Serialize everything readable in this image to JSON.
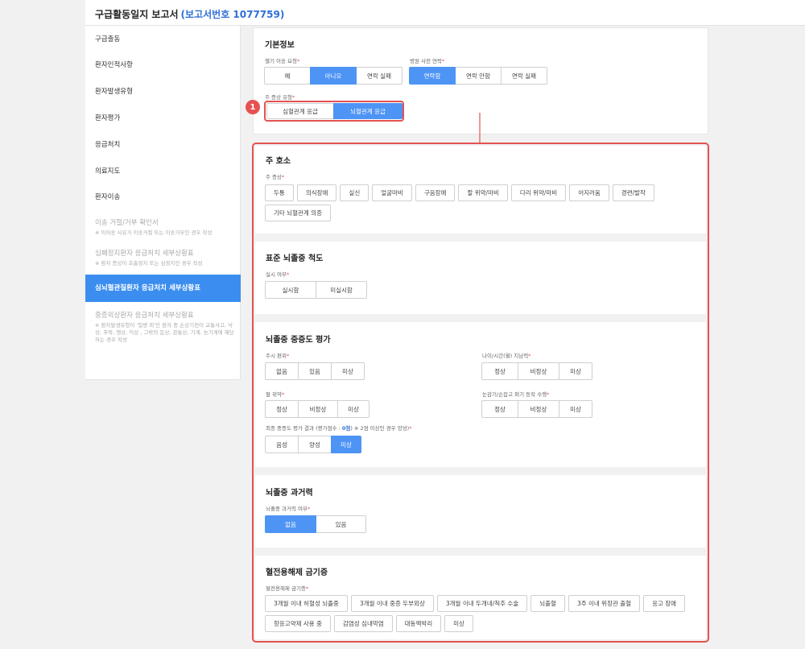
{
  "header": {
    "title": "구급활동일지 보고서",
    "report_no": "(보고서번호 1077759)"
  },
  "sidebar": {
    "items": [
      {
        "label": "구급출동"
      },
      {
        "label": "환자인적사항"
      },
      {
        "label": "환자발생유형"
      },
      {
        "label": "환자평가"
      },
      {
        "label": "응급처치"
      },
      {
        "label": "의료지도"
      },
      {
        "label": "환자이송"
      },
      {
        "label": "이송 거절/거부 확인서",
        "note": "※ 이어송 사유가 이송거절 또는 이송거부인 경우 작성"
      },
      {
        "label": "심폐정지환자 응급처치 세부상황표",
        "note": "※ 환자 증상이 호흡정지 또는 심정지인 경우 작성"
      },
      {
        "label": "심뇌혈관질환자 응급처치 세부상황표"
      },
      {
        "label": "중증외상환자 응급처치 세부상황표",
        "note": "※ 환자발생유형이 '질병 외'인 환자 중 손상기전이 교통사고, 낙상, 추락, 행상, 익상 , 그밖의 둔상, 관통상, 기계, 농기계에 해당하는 경우 작성"
      }
    ]
  },
  "basic": {
    "title": "기본정보",
    "heli": {
      "label": "헬기 이송 요청",
      "options": [
        "예",
        "아니오",
        "연락 실패"
      ],
      "selected": 1
    },
    "hospital": {
      "label": "병원 사전 연락",
      "options": [
        "연락함",
        "연락 안함",
        "연락 실패"
      ],
      "selected": 0
    },
    "symptom_type": {
      "label": "주 증상 유형",
      "options": [
        "심혈관계 응급",
        "뇌혈관계 응급"
      ],
      "selected": 1
    },
    "badge": "1"
  },
  "chief": {
    "title": "주 호소",
    "label": "주 증상",
    "chips": [
      "두통",
      "의식장애",
      "실신",
      "얼굴마비",
      "구음장애",
      "팔 위약/마비",
      "다리 위약/마비",
      "어지러움",
      "경련/발작",
      "기타 뇌혈관계 의증"
    ]
  },
  "scale": {
    "title": "표준 뇌졸중 척도",
    "label": "실시 여부",
    "options": [
      "실시함",
      "미실시함"
    ]
  },
  "severity": {
    "title": "뇌졸중 중증도 평가",
    "gaze": {
      "label": "주시 편위",
      "options": [
        "없음",
        "있음",
        "미상"
      ]
    },
    "orientation": {
      "label": "나이/시간(월) 지남력",
      "options": [
        "정상",
        "비정상",
        "미상"
      ]
    },
    "arm": {
      "label": "팔 위약",
      "options": [
        "정상",
        "비정상",
        "미상"
      ]
    },
    "eye": {
      "label": "눈감기/손잡고 펴기 동작 수행",
      "options": [
        "정상",
        "비정상",
        "미상"
      ]
    },
    "result": {
      "label_a": "최종 중증도 평가 결과 (평가점수 : ",
      "score": "0점",
      "label_b": ") ※ 2점 이상인 경우 양성)",
      "options": [
        "음성",
        "양성",
        "미상"
      ],
      "selected": 2
    }
  },
  "history": {
    "title": "뇌졸중 과거력",
    "label": "뇌졸중 과거력 여부",
    "options": [
      "없음",
      "있음"
    ],
    "selected": 0
  },
  "thrombo": {
    "title": "혈전용해제 금기증",
    "label": "혈전용해제 금기증",
    "chips": [
      "3개월 이내 허혈성 뇌졸중",
      "3개월 이내 중증 두부외상",
      "3개월 이내 두개내/척추 수술",
      "뇌출혈",
      "3주 이내 위장관 출혈",
      "응고 장애",
      "항응고약제 사용 중",
      "감염성 심내막염",
      "대동맥박리",
      "미상"
    ]
  },
  "colors": {
    "accent": "#4e94f5",
    "highlight": "#e55252",
    "sidebar_active": "#3b8ef0"
  }
}
